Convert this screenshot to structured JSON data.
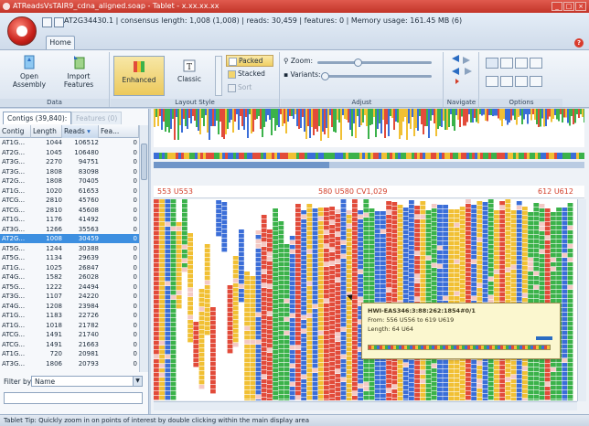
{
  "window": {
    "title": "ATReadsVsTAIR9_cdna_aligned.soap - Tablet - x.xx.xx.xx",
    "controls": [
      "_",
      "□",
      "×"
    ]
  },
  "header": {
    "contig_info": "AT2G34430.1  |  consensus length: 1,008 (1,008)  |  reads: 30,459  |  features: 0  |  Memory usage: 161.45 MB (6)"
  },
  "ribbon": {
    "home_tab": "Home",
    "data": {
      "group_label": "Data",
      "open_label_1": "Open",
      "open_label_2": "Assembly",
      "import_label_1": "Import",
      "import_label_2": "Features"
    },
    "layout": {
      "group_label": "Layout Style",
      "enhanced": "Enhanced",
      "classic": "Classic",
      "packed": "Packed",
      "stacked": "Stacked",
      "sort": "Sort"
    },
    "adjust": {
      "group_label": "Adjust",
      "zoom_label": "Zoom:",
      "variants_label": "Variants:",
      "zoom_level": 0.35,
      "variants_level": 0.02
    },
    "navigate": {
      "group_label": "Navigate"
    },
    "options": {
      "group_label": "Options"
    }
  },
  "left": {
    "tab_contigs": "Contigs (39,840):",
    "tab_features": "Features (0)",
    "columns": [
      "Contig",
      "Length",
      "Reads",
      "Fea..."
    ],
    "rows": [
      [
        "AT1G...",
        "1044",
        "106512",
        "0"
      ],
      [
        "AT2G...",
        "1045",
        "106480",
        "0"
      ],
      [
        "AT3G...",
        "2270",
        "94751",
        "0"
      ],
      [
        "AT3G...",
        "1808",
        "83098",
        "0"
      ],
      [
        "AT2G...",
        "1808",
        "70405",
        "0"
      ],
      [
        "AT1G...",
        "1020",
        "61653",
        "0"
      ],
      [
        "ATCG...",
        "2810",
        "45760",
        "0"
      ],
      [
        "ATCG...",
        "2810",
        "45608",
        "0"
      ],
      [
        "AT1G...",
        "1176",
        "41492",
        "0"
      ],
      [
        "AT3G...",
        "1266",
        "35563",
        "0"
      ],
      [
        "AT2G...",
        "1008",
        "30459",
        "0"
      ],
      [
        "AT5G...",
        "1244",
        "30388",
        "0"
      ],
      [
        "AT5G...",
        "1134",
        "29639",
        "0"
      ],
      [
        "AT1G...",
        "1025",
        "26847",
        "0"
      ],
      [
        "AT4G...",
        "1582",
        "26028",
        "0"
      ],
      [
        "AT5G...",
        "1222",
        "24494",
        "0"
      ],
      [
        "AT3G...",
        "1107",
        "24220",
        "0"
      ],
      [
        "AT4G...",
        "1208",
        "23984",
        "0"
      ],
      [
        "AT1G...",
        "1183",
        "22726",
        "0"
      ],
      [
        "AT1G...",
        "1018",
        "21782",
        "0"
      ],
      [
        "ATCG...",
        "1491",
        "21740",
        "0"
      ],
      [
        "ATCG...",
        "1491",
        "21663",
        "0"
      ],
      [
        "AT1G...",
        "720",
        "20981",
        "0"
      ],
      [
        "AT3G...",
        "1806",
        "20793",
        "0"
      ]
    ],
    "selected_row": 10,
    "filter_label": "Filter by:",
    "filter_value": "Name"
  },
  "viewer": {
    "ruler_labels": [
      "553 U553",
      "580 U580 CV1,029",
      "612 U612"
    ],
    "tooltip": {
      "name": "HWI-EAS346:3:88:262:1854#0/1",
      "from": "From: 556 U556 to 619 U619",
      "length": "Length: 64 U64"
    },
    "colors": {
      "A": "#3bb24a",
      "C": "#3b6ed8",
      "G": "#f1c034",
      "T": "#e24b3a",
      "alt": "#a86fc0"
    }
  },
  "status": {
    "tip": "Tablet Tip:  Quickly zoom in on points of interest by double clicking within the main display area"
  }
}
